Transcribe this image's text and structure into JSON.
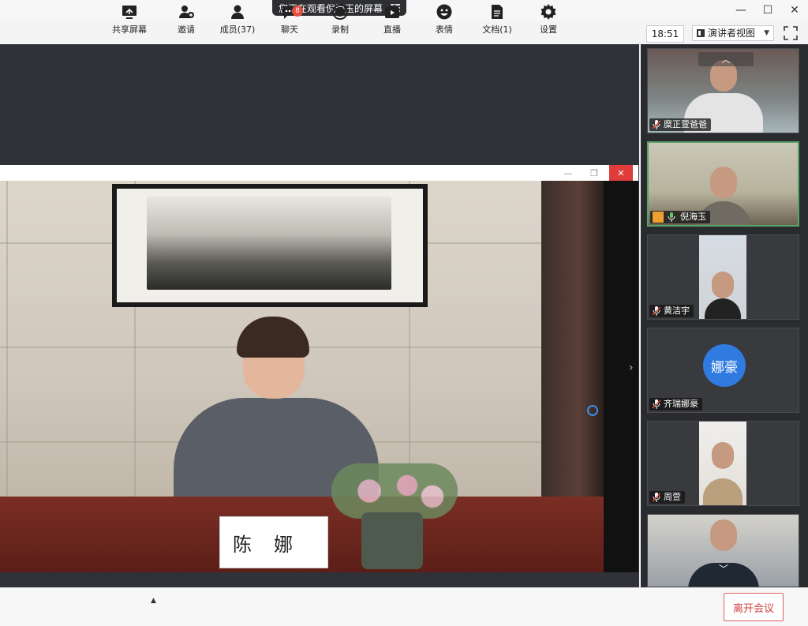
{
  "top": {
    "share_notice": "您正在观看倪海玉的屏幕",
    "clock": "18:51",
    "view_mode": "演讲者视图"
  },
  "main_video": {
    "nameplate": "陈娜"
  },
  "participants": [
    {
      "name": "糜正萱爸爸",
      "muted": true
    },
    {
      "name": "倪海玉",
      "muted": false,
      "active": true
    },
    {
      "name": "黄洁宇",
      "muted": true
    },
    {
      "name": "齐瑞娜豪",
      "muted": true,
      "avatar": "娜豪"
    },
    {
      "name": "周萱",
      "muted": true
    },
    {
      "name": "",
      "muted": true
    }
  ],
  "toolbar": {
    "share": "共享屏幕",
    "invite": "邀请",
    "members": "成员(37)",
    "chat": "聊天",
    "chat_badge": "8",
    "record": "录制",
    "live": "直播",
    "emoji": "表情",
    "docs": "文档(1)",
    "settings": "设置",
    "leave": "离开会议"
  },
  "colors": {
    "active_border": "#5aa469",
    "leave": "#d04040",
    "avatar": "#2f7be0"
  }
}
